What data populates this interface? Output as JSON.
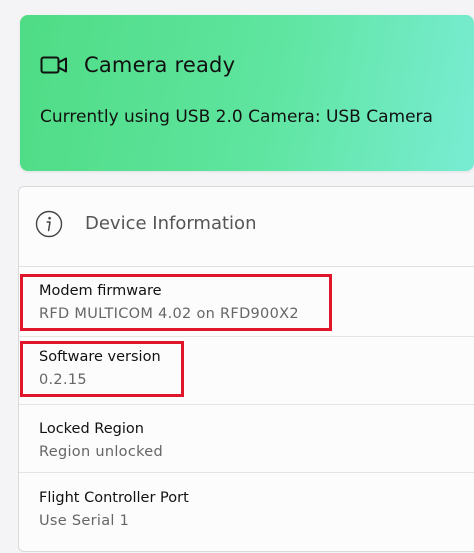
{
  "camera": {
    "icon": "camera-icon",
    "title": "Camera ready",
    "description": "Currently using USB 2.0 Camera: USB Camera",
    "gradient_start": "#4fdc85",
    "gradient_end": "#79ecd3"
  },
  "device_info": {
    "icon": "info-icon",
    "title": "Device Information",
    "rows": [
      {
        "label": "Modem firmware",
        "value": "RFD MULTICOM 4.02 on RFD900X2"
      },
      {
        "label": "Software version",
        "value": "0.2.15"
      },
      {
        "label": "Locked Region",
        "value": "Region unlocked"
      },
      {
        "label": "Flight Controller Port",
        "value": "Use Serial 1"
      }
    ]
  },
  "highlight_color": "#e0162b"
}
